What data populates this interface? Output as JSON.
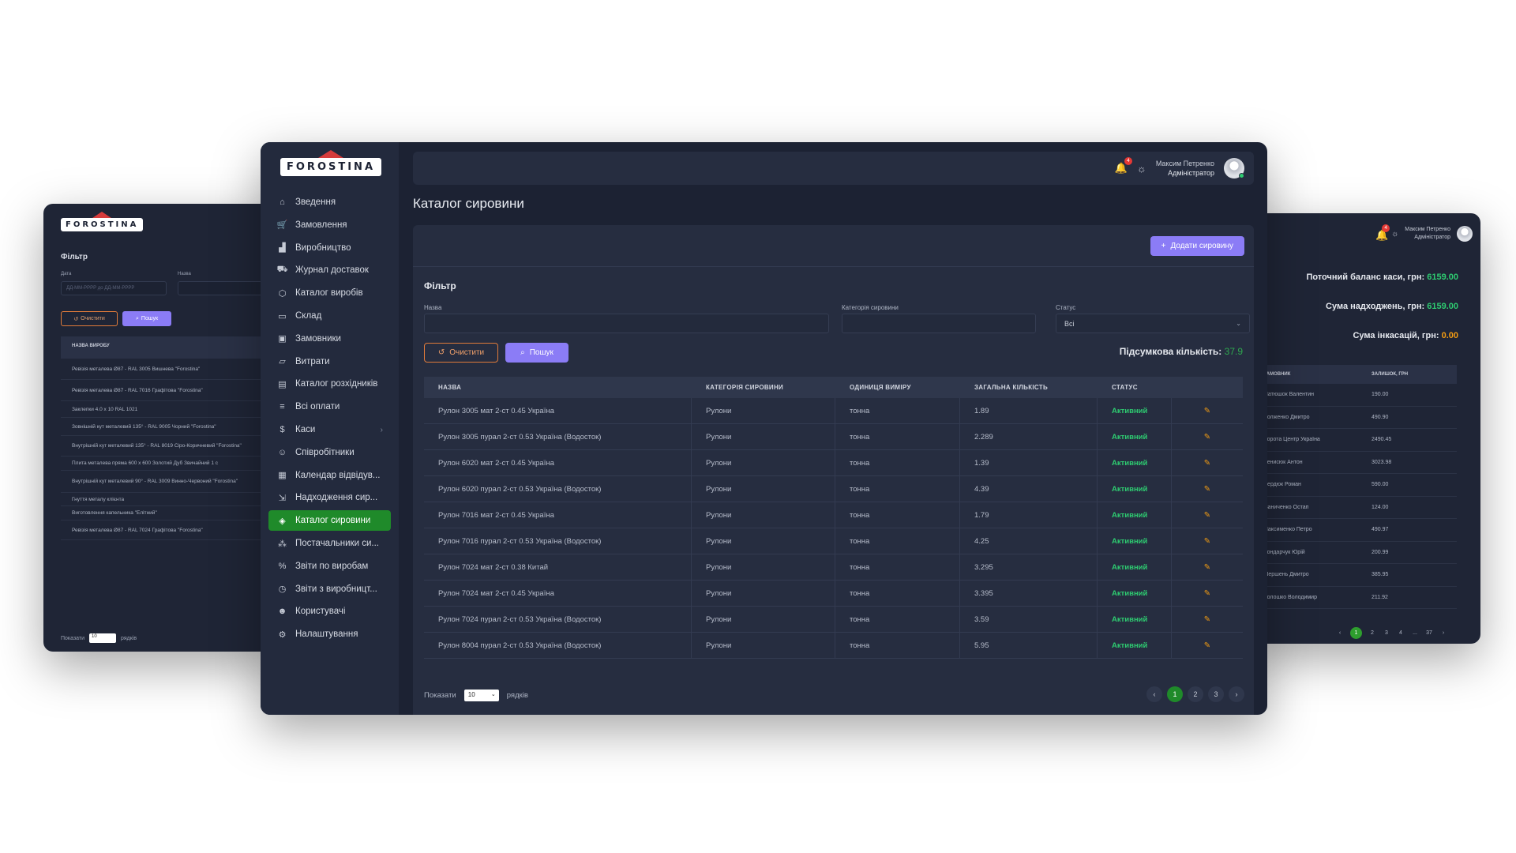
{
  "brand": {
    "logo_text": "FOROSTINA"
  },
  "left_window": {
    "filter_title": "Фільтр",
    "date_label": "Дата",
    "date_placeholder": "ДД-ММ-РРРР до ДД-ММ-РРРР",
    "name_label": "Назва",
    "clear_label": "Очистити",
    "search_label": "Пошук",
    "table_header": "НАЗВА ВИРОБУ",
    "rows": [
      "Ревізія металева Ø87 - RAL 3005 Вишнева \"Forostina\"",
      "Ревізія металева Ø87 - RAL 7016 Графітова \"Forostina\"",
      "Заклепки 4.0 х 10 RAL 1021",
      "Зовнішній кут металевий 135° - RAL 9005 Чорний \"Forostina\"",
      "Внутрішній кут металевий 135° - RAL 8019 Сіро-Коричневий \"Forostina\"",
      "Плита металева пряма 600 х 600 Золотий Дуб Звичайний 1 с",
      "Внутрішній кут металевий 90° - RAL 3009 Винно-Червоний \"Forostina\"",
      "Гнуття металу клієнта",
      "Виготовлення капельника \"Елітний\"",
      "Ревізія металева Ø87 - RAL 7024 Графітова \"Forostina\""
    ],
    "show_label": "Показати",
    "rows_value": "10",
    "rows_label": "рядків"
  },
  "right_window": {
    "user_name": "Максим Петренко",
    "user_role": "Адміністратор",
    "notif_count": "4",
    "stats": [
      {
        "label": "Поточний баланс каси, грн:",
        "value": "6159.00",
        "color": "g"
      },
      {
        "label": "Сума надходжень, грн:",
        "value": "6159.00",
        "color": "g"
      },
      {
        "label": "Сума інкасацій, грн:",
        "value": "0.00",
        "color": "o"
      }
    ],
    "col_client": "ЗАМОВНИК",
    "col_balance": "ЗАЛИШОК, ГРН",
    "rows": [
      {
        "client": "Матюшок Валентин",
        "balance": "190.00"
      },
      {
        "client": "Долженко Дмитро",
        "balance": "490.90"
      },
      {
        "client": "Ворота Центр Україна",
        "balance": "2490.45"
      },
      {
        "client": "Денисюк Антон",
        "balance": "3023.98"
      },
      {
        "client": "Сердюк Роман",
        "balance": "590.00"
      },
      {
        "client": "Іваниченко Остап",
        "balance": "124.00"
      },
      {
        "client": "Максименко Петро",
        "balance": "490.97"
      },
      {
        "client": "Бондарчук Юрій",
        "balance": "200.99"
      },
      {
        "client": "Шершень Дмитро",
        "balance": "385.95"
      },
      {
        "client": "Волошко Володимир",
        "balance": "211.92"
      }
    ],
    "pages": [
      "‹",
      "1",
      "2",
      "3",
      "4",
      "...",
      "37",
      "›"
    ]
  },
  "sidebar": {
    "items": [
      {
        "label": "Зведення",
        "icon": "home-icon",
        "glyph": "⌂"
      },
      {
        "label": "Замовлення",
        "icon": "cart-icon",
        "glyph": "🛒"
      },
      {
        "label": "Виробництво",
        "icon": "factory-icon",
        "glyph": "▟"
      },
      {
        "label": "Журнал доставок",
        "icon": "truck-icon",
        "glyph": "⛟"
      },
      {
        "label": "Каталог виробів",
        "icon": "box-icon",
        "glyph": "⬡"
      },
      {
        "label": "Склад",
        "icon": "archive-icon",
        "glyph": "▭"
      },
      {
        "label": "Замовники",
        "icon": "briefcase-icon",
        "glyph": "▣"
      },
      {
        "label": "Витрати",
        "icon": "folder-icon",
        "glyph": "▱"
      },
      {
        "label": "Каталог розхідників",
        "icon": "book-icon",
        "glyph": "▤"
      },
      {
        "label": "Всі оплати",
        "icon": "database-icon",
        "glyph": "≡"
      },
      {
        "label": "Каси",
        "icon": "dollar-icon",
        "glyph": "$"
      },
      {
        "label": "Співробітники",
        "icon": "user-icon",
        "glyph": "☺"
      },
      {
        "label": "Календар відвідув...",
        "icon": "calendar-icon",
        "glyph": "▦"
      },
      {
        "label": "Надходження сир...",
        "icon": "file-in-icon",
        "glyph": "⇲"
      },
      {
        "label": "Каталог сировини",
        "icon": "layers-icon",
        "glyph": "◈"
      },
      {
        "label": "Постачальники си...",
        "icon": "users-icon",
        "glyph": "⁂"
      },
      {
        "label": "Звіти по виробам",
        "icon": "percent-icon",
        "glyph": "%"
      },
      {
        "label": "Звіти з виробницт...",
        "icon": "clock-icon",
        "glyph": "◷"
      },
      {
        "label": "Користувачі",
        "icon": "users-group-icon",
        "glyph": "☻"
      },
      {
        "label": "Налаштування",
        "icon": "gear-icon",
        "glyph": "⚙"
      }
    ],
    "active_index": 14
  },
  "header": {
    "notif_count": "4",
    "user_name": "Максим Петренко",
    "user_role": "Адміністратор"
  },
  "page": {
    "title": "Каталог сировини",
    "add_button": "Додати сировину",
    "filter_title": "Фільтр",
    "name_label": "Назва",
    "category_label": "Категорія сировини",
    "status_label": "Статус",
    "status_value": "Всі",
    "clear_label": "Очистити",
    "search_label": "Пошук",
    "total_label": "Підсумкова кількість:",
    "total_value": "37.9"
  },
  "table": {
    "headers": [
      "НАЗВА",
      "КАТЕГОРІЯ СИРОВИНИ",
      "ОДИНИЦЯ ВИМІРУ",
      "ЗАГАЛЬНА КІЛЬКІСТЬ",
      "СТАТУС"
    ],
    "rows": [
      {
        "name": "Рулон 3005 мат 2-ст 0.45 Україна",
        "category": "Рулони",
        "unit": "тонна",
        "qty": "1.89",
        "status": "Активний"
      },
      {
        "name": "Рулон 3005 пурал 2-ст 0.53 Україна (Водосток)",
        "category": "Рулони",
        "unit": "тонна",
        "qty": "2.289",
        "status": "Активний"
      },
      {
        "name": "Рулон 6020 мат 2-ст 0.45 Україна",
        "category": "Рулони",
        "unit": "тонна",
        "qty": "1.39",
        "status": "Активний"
      },
      {
        "name": "Рулон 6020 пурал 2-ст 0.53 Україна (Водосток)",
        "category": "Рулони",
        "unit": "тонна",
        "qty": "4.39",
        "status": "Активний"
      },
      {
        "name": "Рулон 7016 мат 2-ст 0.45 Україна",
        "category": "Рулони",
        "unit": "тонна",
        "qty": "1.79",
        "status": "Активний"
      },
      {
        "name": "Рулон 7016 пурал 2-ст 0.53 Україна (Водосток)",
        "category": "Рулони",
        "unit": "тонна",
        "qty": "4.25",
        "status": "Активний"
      },
      {
        "name": "Рулон 7024 мат 2-ст 0.38 Китай",
        "category": "Рулони",
        "unit": "тонна",
        "qty": "3.295",
        "status": "Активний"
      },
      {
        "name": "Рулон 7024 мат 2-ст 0.45 Україна",
        "category": "Рулони",
        "unit": "тонна",
        "qty": "3.395",
        "status": "Активний"
      },
      {
        "name": "Рулон 7024 пурал 2-ст 0.53 Україна (Водосток)",
        "category": "Рулони",
        "unit": "тонна",
        "qty": "3.59",
        "status": "Активний"
      },
      {
        "name": "Рулон 8004 пурал 2-ст 0.53 Україна (Водосток)",
        "category": "Рулони",
        "unit": "тонна",
        "qty": "5.95",
        "status": "Активний"
      }
    ]
  },
  "footer": {
    "show_label": "Показати",
    "rows_value": "10",
    "rows_label": "рядків",
    "pages": [
      "‹",
      "1",
      "2",
      "3",
      "›"
    ],
    "active_page": "1"
  },
  "colors": {
    "accent": "#8b7cf6",
    "active_nav": "#1f8a2a",
    "status_active": "#2ecc71",
    "clear_button": "#e07b3a"
  }
}
